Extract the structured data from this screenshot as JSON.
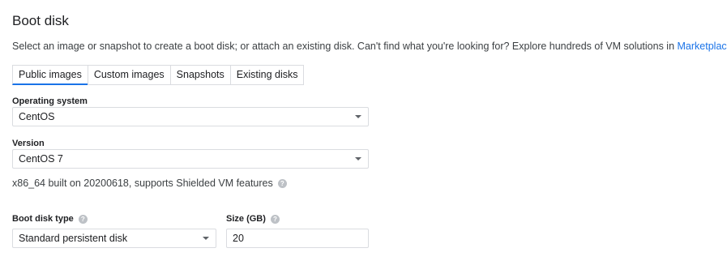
{
  "section": {
    "title": "Boot disk",
    "description": "Select an image or snapshot to create a boot disk; or attach an existing disk. Can't find what you're looking for? Explore hundreds of VM solutions in ",
    "link_text": "Marketplace",
    "description_end": "."
  },
  "tabs": [
    {
      "label": "Public images",
      "active": true
    },
    {
      "label": "Custom images",
      "active": false
    },
    {
      "label": "Snapshots",
      "active": false
    },
    {
      "label": "Existing disks",
      "active": false
    }
  ],
  "os": {
    "label": "Operating system",
    "value": "CentOS"
  },
  "version": {
    "label": "Version",
    "value": "CentOS 7"
  },
  "image_note": "x86_64 built on 20200618, supports Shielded VM features",
  "disk_type": {
    "label": "Boot disk type",
    "value": "Standard persistent disk"
  },
  "size": {
    "label": "Size (GB)",
    "value": "20"
  },
  "help_glyph": "?",
  "colors": {
    "accent": "#1a73e8",
    "border": "#dadce0",
    "text": "#202124",
    "help_icon": "#bdc1c6"
  }
}
